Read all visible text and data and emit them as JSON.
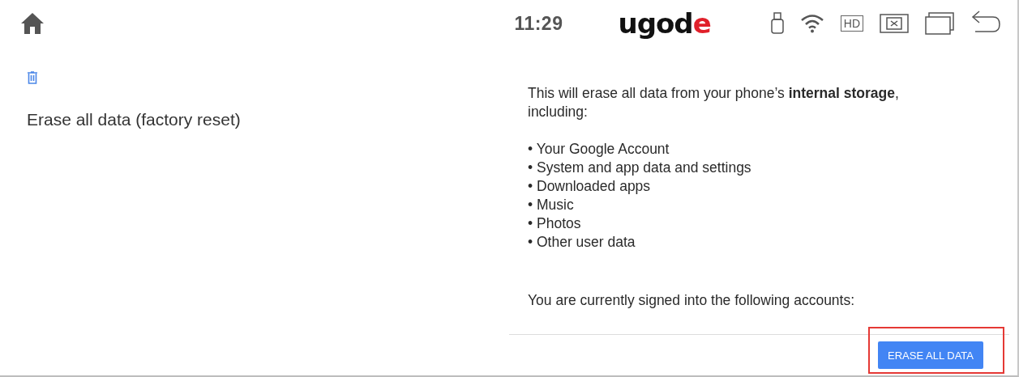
{
  "status_bar": {
    "time": "11:29",
    "logo": {
      "main": "ugod",
      "accent": "e"
    },
    "hd_label": "HD"
  },
  "left_panel": {
    "title": "Erase all data (factory reset)"
  },
  "details": {
    "intro": "This will erase all data from your phone’s **internal storage**, including:",
    "items": [
      "• Your Google Account",
      "• System and app data and settings",
      "• Downloaded apps",
      "• Music",
      "• Photos",
      "• Other user data"
    ],
    "accounts_note": "You are currently signed into the following accounts:"
  },
  "action": {
    "label": "ERASE ALL DATA",
    "highlighted": true
  }
}
